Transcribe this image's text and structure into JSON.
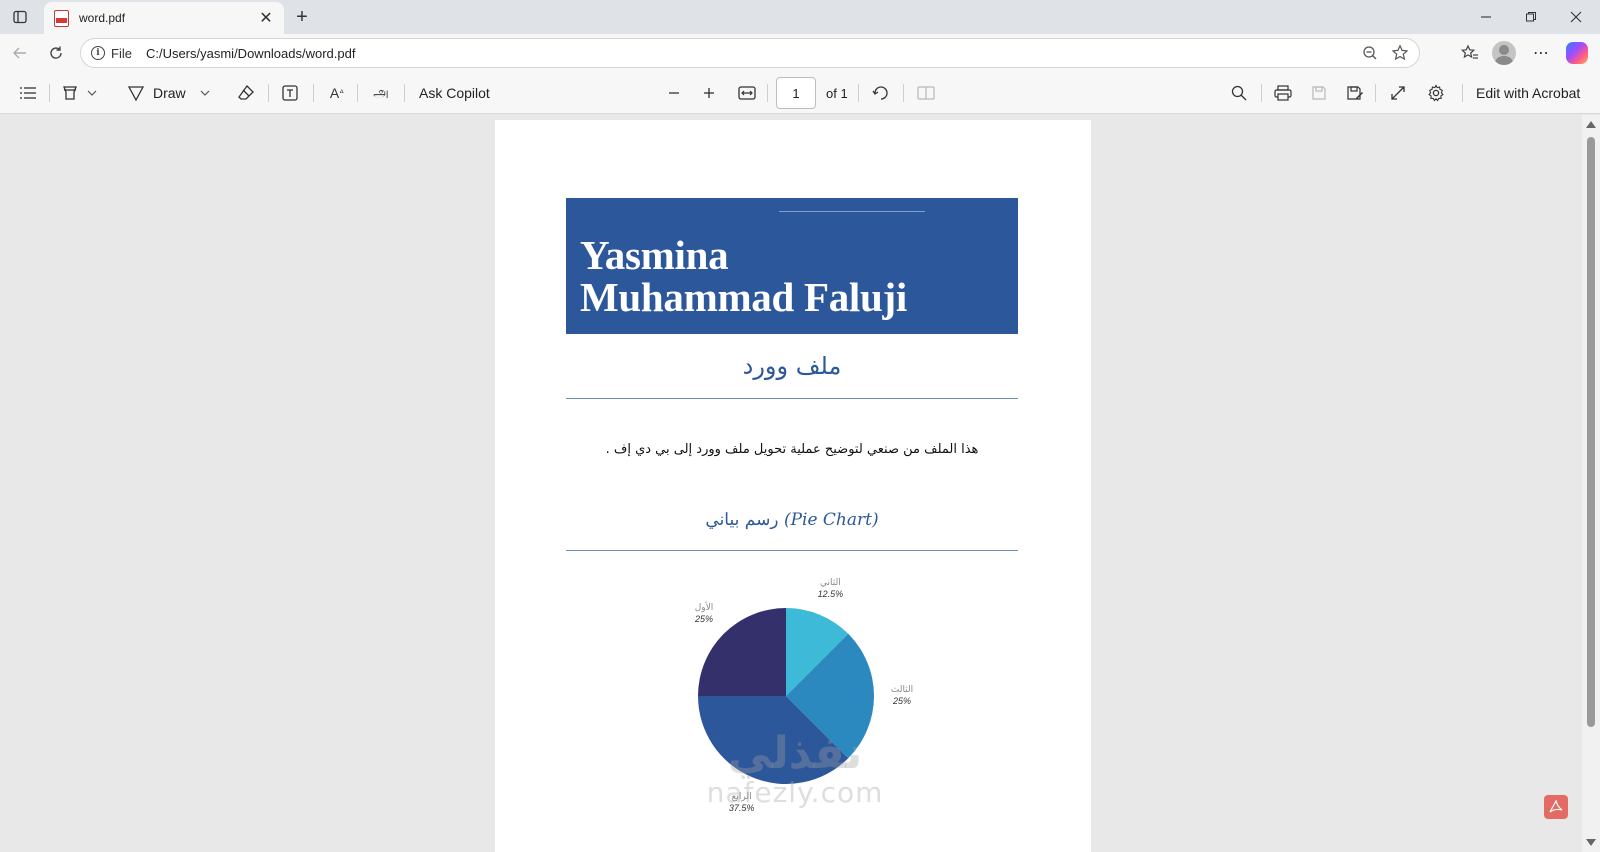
{
  "browser": {
    "tab": {
      "title": "word.pdf"
    },
    "address": {
      "scheme_label": "File",
      "url": "C:/Users/yasmi/Downloads/word.pdf"
    }
  },
  "pdf_toolbar": {
    "draw_label": "Draw",
    "ask_copilot_label": "Ask Copilot",
    "page_current": "1",
    "page_total": "of 1",
    "edit_acrobat_label": "Edit with Acrobat"
  },
  "document": {
    "banner_name_line1": "Yasmina",
    "banner_name_line2": "Muhammad Faluji",
    "heading": "ملف وورد",
    "paragraph": "هذا الملف من صنعي لتوضيح عملية تحويل ملف وورد إلى بي دي إف .",
    "chart_heading_ar": "رسم بياني",
    "chart_heading_en": "(Pie Chart)",
    "watermark_ar": "نفذلي",
    "watermark_latin": "nafezly.com"
  },
  "chart_data": {
    "type": "pie",
    "labels": [
      "الأول",
      "الثاني",
      "الثالث",
      "الرابع"
    ],
    "values": [
      25,
      12.5,
      25,
      37.5
    ],
    "value_labels": [
      "25%",
      "12.5%",
      "25%",
      "37.5%"
    ],
    "colors": [
      "#33306c",
      "#3cbad7",
      "#2c89c0",
      "#2d579b"
    ]
  }
}
